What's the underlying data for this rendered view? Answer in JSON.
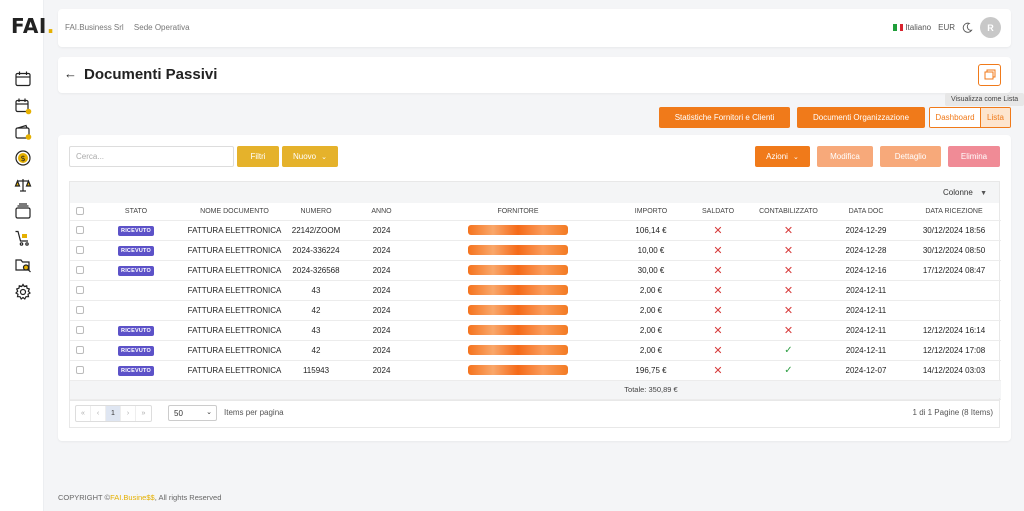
{
  "sidebar": {
    "logo_text": "FAI",
    "logo_dot": ".",
    "icons": [
      "calendar-icon",
      "calendar-alert-icon",
      "wallet-icon",
      "dollar-coin-icon",
      "scale-icon",
      "folder-stack-icon",
      "cart-icon",
      "folder-search-icon",
      "settings-gear-icon"
    ]
  },
  "topbar": {
    "company": "FAI.Business Srl",
    "location": "Sede Operativa",
    "language": "Italiano",
    "currency": "EUR",
    "avatar": "R"
  },
  "page": {
    "title": "Documenti Passivi",
    "tooltip": "Visualizza come Lista"
  },
  "actions": {
    "statistiche": "Statistiche Fornitori e Clienti",
    "documenti_org": "Documenti Organizzazione",
    "dashboard": "Dashboard",
    "lista": "Lista"
  },
  "toolbar": {
    "search_placeholder": "Cerca...",
    "filtri": "Filtri",
    "nuovo": "Nuovo",
    "azioni": "Azioni",
    "modifica": "Modifica",
    "dettaglio": "Dettaglio",
    "elimina": "Elimina",
    "colonne": "Colonne"
  },
  "table": {
    "headers": [
      "STATO",
      "NOME DOCUMENTO",
      "NUMERO",
      "ANNO",
      "FORNITORE",
      "IMPORTO",
      "SALDATO",
      "CONTABILIZZATO",
      "DATA DOC",
      "DATA RICEZIONE"
    ],
    "rows": [
      {
        "stato": "RICEVUTO",
        "nome": "FATTURA ELETTRONICA",
        "numero": "22142/ZOOM",
        "anno": "2024",
        "importo": "106,14 €",
        "saldato": false,
        "contabilizzato": false,
        "data_doc": "2024-12-29",
        "data_ricezione": "30/12/2024 18:56"
      },
      {
        "stato": "RICEVUTO",
        "nome": "FATTURA ELETTRONICA",
        "numero": "2024-336224",
        "anno": "2024",
        "importo": "10,00 €",
        "saldato": false,
        "contabilizzato": false,
        "data_doc": "2024-12-28",
        "data_ricezione": "30/12/2024 08:50"
      },
      {
        "stato": "RICEVUTO",
        "nome": "FATTURA ELETTRONICA",
        "numero": "2024-326568",
        "anno": "2024",
        "importo": "30,00 €",
        "saldato": false,
        "contabilizzato": false,
        "data_doc": "2024-12-16",
        "data_ricezione": "17/12/2024 08:47"
      },
      {
        "stato": "",
        "nome": "FATTURA ELETTRONICA",
        "numero": "43",
        "anno": "2024",
        "importo": "2,00 €",
        "saldato": false,
        "contabilizzato": false,
        "data_doc": "2024-12-11",
        "data_ricezione": ""
      },
      {
        "stato": "",
        "nome": "FATTURA ELETTRONICA",
        "numero": "42",
        "anno": "2024",
        "importo": "2,00 €",
        "saldato": false,
        "contabilizzato": false,
        "data_doc": "2024-12-11",
        "data_ricezione": ""
      },
      {
        "stato": "RICEVUTO",
        "nome": "FATTURA ELETTRONICA",
        "numero": "43",
        "anno": "2024",
        "importo": "2,00 €",
        "saldato": false,
        "contabilizzato": false,
        "data_doc": "2024-12-11",
        "data_ricezione": "12/12/2024 16:14"
      },
      {
        "stato": "RICEVUTO",
        "nome": "FATTURA ELETTRONICA",
        "numero": "42",
        "anno": "2024",
        "importo": "2,00 €",
        "saldato": false,
        "contabilizzato": true,
        "data_doc": "2024-12-11",
        "data_ricezione": "12/12/2024 17:08"
      },
      {
        "stato": "RICEVUTO",
        "nome": "FATTURA ELETTRONICA",
        "numero": "115943",
        "anno": "2024",
        "importo": "196,75 €",
        "saldato": false,
        "contabilizzato": true,
        "data_doc": "2024-12-07",
        "data_ricezione": "14/12/2024 03:03"
      }
    ],
    "total": "Totale: 350,89 €"
  },
  "pagination": {
    "first": "«",
    "prev": "‹",
    "current": "1",
    "next": "›",
    "last": "»",
    "page_size": "50",
    "page_size_label": "Items per pagina",
    "info": "1 di 1 Pagine (8 Items)"
  },
  "footer": {
    "prefix": "COPYRIGHT ©",
    "brand": "FAI.Busine$$",
    "suffix": ", All rights Reserved"
  },
  "colors": {
    "accent": "#f07a1a",
    "brand_yellow": "#e5b000",
    "badge": "#5c52c8",
    "danger": "#d63b3b",
    "success": "#2f9e44"
  }
}
